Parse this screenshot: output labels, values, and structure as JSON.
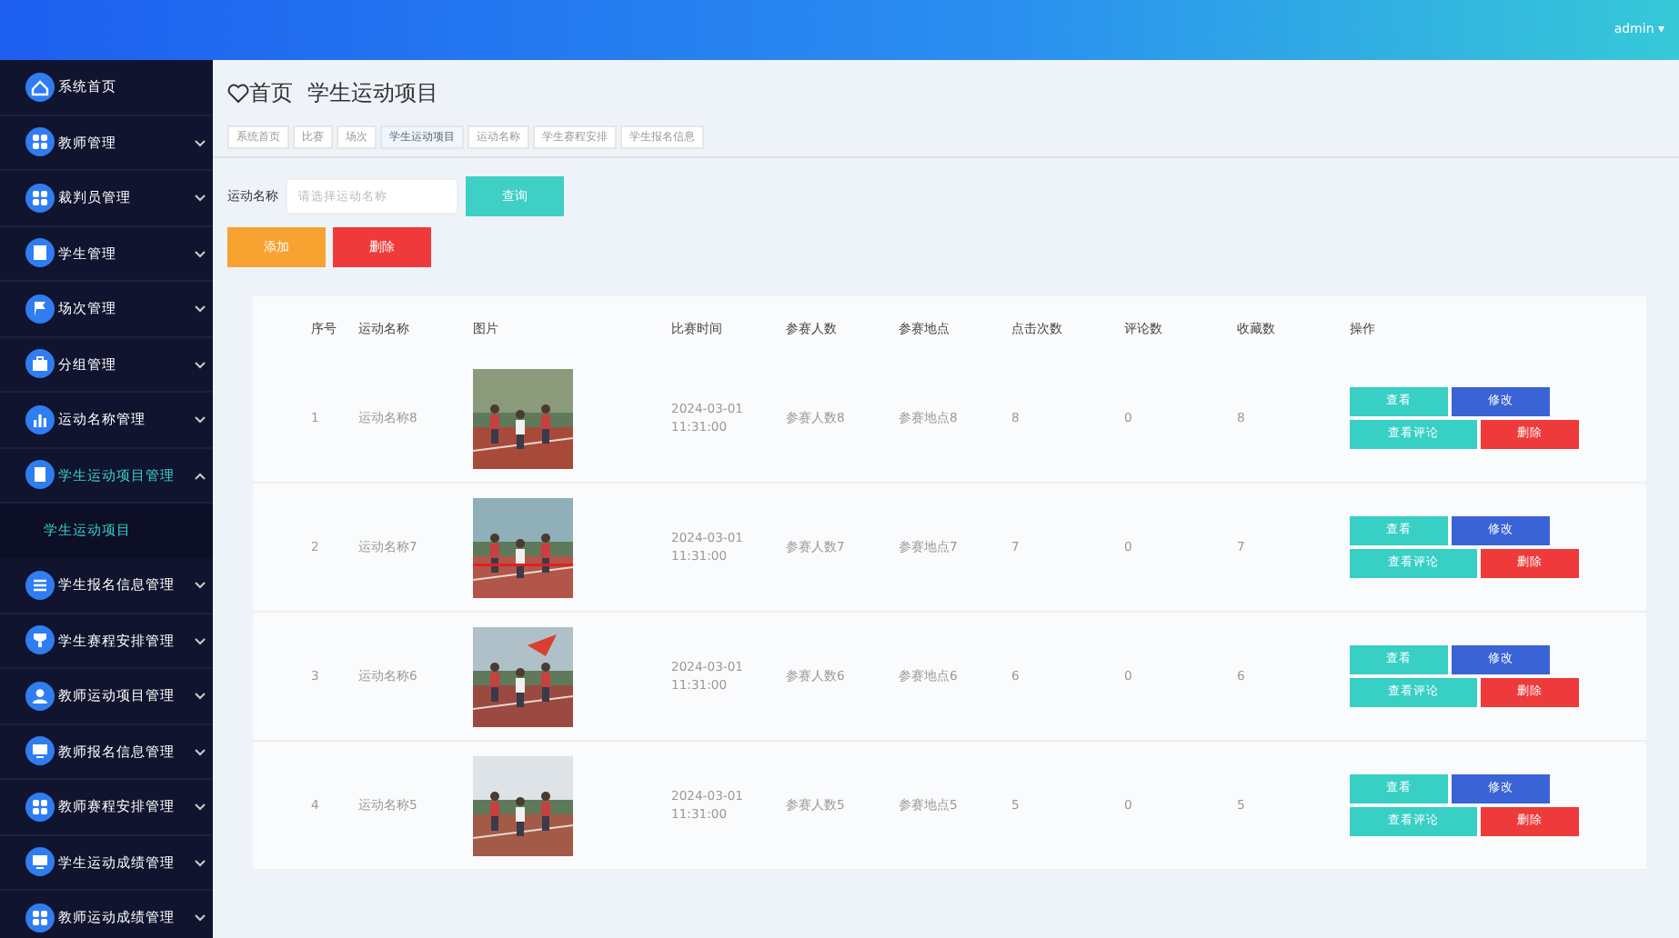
{
  "header": {
    "user": "admin",
    "caret": "▾"
  },
  "sidebar": {
    "items": [
      {
        "label": "系统首页",
        "expanded": false,
        "has_arrow": false
      },
      {
        "label": "教师管理",
        "expanded": false,
        "has_arrow": true
      },
      {
        "label": "裁判员管理",
        "expanded": false,
        "has_arrow": true
      },
      {
        "label": "学生管理",
        "expanded": false,
        "has_arrow": true
      },
      {
        "label": "场次管理",
        "expanded": false,
        "has_arrow": true
      },
      {
        "label": "分组管理",
        "expanded": false,
        "has_arrow": true
      },
      {
        "label": "运动名称管理",
        "expanded": false,
        "has_arrow": true
      },
      {
        "label": "学生运动项目管理",
        "expanded": true,
        "has_arrow": true,
        "children": [
          {
            "label": "学生运动项目",
            "selected": true
          }
        ]
      },
      {
        "label": "学生报名信息管理",
        "expanded": false,
        "has_arrow": true
      },
      {
        "label": "学生赛程安排管理",
        "expanded": false,
        "has_arrow": true
      },
      {
        "label": "教师运动项目管理",
        "expanded": false,
        "has_arrow": true
      },
      {
        "label": "教师报名信息管理",
        "expanded": false,
        "has_arrow": true
      },
      {
        "label": "教师赛程安排管理",
        "expanded": false,
        "has_arrow": true
      },
      {
        "label": "学生运动成绩管理",
        "expanded": false,
        "has_arrow": true
      },
      {
        "label": "教师运动成绩管理",
        "expanded": false,
        "has_arrow": true
      }
    ]
  },
  "breadcrumb": [
    "首页",
    "学生运动项目"
  ],
  "tabs": [
    {
      "label": "系统首页",
      "selected": false
    },
    {
      "label": "比赛",
      "selected": false
    },
    {
      "label": "场次",
      "selected": false
    },
    {
      "label": "学生运动项目",
      "selected": true
    },
    {
      "label": "运动名称",
      "selected": false
    },
    {
      "label": "学生赛程安排",
      "selected": false
    },
    {
      "label": "学生报名信息",
      "selected": false
    }
  ],
  "search": {
    "label": "运动名称",
    "placeholder": "请选择运动名称",
    "button": "查询"
  },
  "actions": [
    {
      "label": "添加",
      "kind": "add"
    },
    {
      "label": "删除",
      "kind": "delete"
    }
  ],
  "table": {
    "columns": [
      "序号",
      "运动名称",
      "图片",
      "比赛时间",
      "参赛人数",
      "参赛地点",
      "点击次数",
      "评论数",
      "收藏数",
      "操作"
    ],
    "rows": [
      {
        "cells": [
          "1",
          "运动名称8",
          {
            "kind": "picture"
          },
          "2024-03-01 11:31:00",
          "参赛人数8",
          "参赛地点8",
          "8",
          "0",
          "8"
        ],
        "actions": [
          {
            "label": "查看",
            "kind": "view"
          },
          {
            "label": "修改",
            "kind": "edit"
          },
          {
            "label": "查看评论",
            "kind": "comments"
          },
          {
            "label": "删除",
            "kind": "delete"
          }
        ]
      },
      {
        "cells": [
          "2",
          "运动名称7",
          {
            "kind": "picture"
          },
          "2024-03-01 11:31:00",
          "参赛人数7",
          "参赛地点7",
          "7",
          "0",
          "7"
        ],
        "actions": [
          {
            "label": "查看",
            "kind": "view"
          },
          {
            "label": "修改",
            "kind": "edit"
          },
          {
            "label": "查看评论",
            "kind": "comments"
          },
          {
            "label": "删除",
            "kind": "delete"
          }
        ]
      },
      {
        "cells": [
          "3",
          "运动名称6",
          {
            "kind": "picture"
          },
          "2024-03-01 11:31:00",
          "参赛人数6",
          "参赛地点6",
          "6",
          "0",
          "6"
        ],
        "actions": [
          {
            "label": "查看",
            "kind": "view"
          },
          {
            "label": "修改",
            "kind": "edit"
          },
          {
            "label": "查看评论",
            "kind": "comments"
          },
          {
            "label": "删除",
            "kind": "delete"
          }
        ]
      },
      {
        "cells": [
          "4",
          "运动名称5",
          {
            "kind": "picture"
          },
          "2024-03-01 11:31:00",
          "参赛人数5",
          "参赛地点5",
          "5",
          "0",
          "5"
        ],
        "actions": [
          {
            "label": "查看",
            "kind": "view"
          },
          {
            "label": "修改",
            "kind": "edit"
          },
          {
            "label": "查看评论",
            "kind": "comments"
          },
          {
            "label": "删除",
            "kind": "delete"
          }
        ]
      }
    ]
  }
}
